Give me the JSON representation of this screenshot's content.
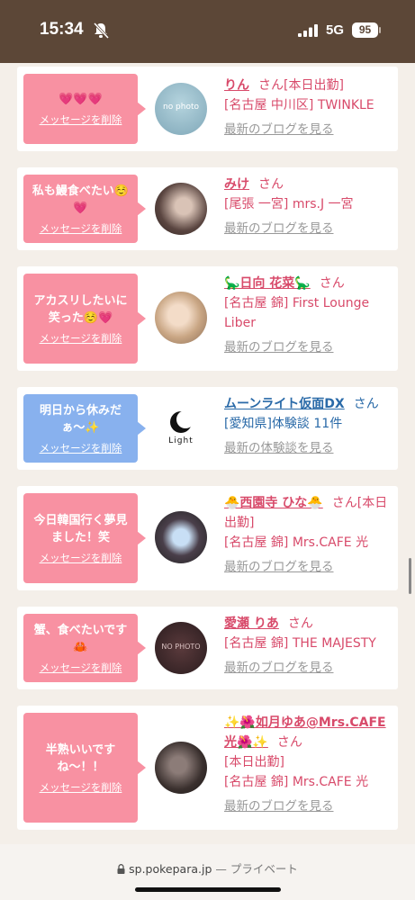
{
  "status_bar": {
    "time": "15:34",
    "network": "5G",
    "battery": "95"
  },
  "cards": [
    {
      "message": "💗💗💗",
      "delete_label": "メッセージを削除",
      "name": "りん",
      "honorific": "さん[本日出勤]",
      "lines": [
        "[名古屋 中川区] TWINKLE"
      ],
      "link": "最新のブログを見る",
      "avatar_text": "no photo"
    },
    {
      "message": "私も鰻食べたい☺️💗",
      "delete_label": "メッセージを削除",
      "name": "みけ",
      "honorific": "さん",
      "lines": [
        "[尾張 一宮] mrs.J 一宮"
      ],
      "link": "最新のブログを見る"
    },
    {
      "message": "アカスリしたいに笑った☺️💗",
      "delete_label": "メッセージを削除",
      "name": "🦕日向 花菜🦕",
      "honorific": "さん",
      "lines": [
        "[名古屋 錦] First Lounge Liber"
      ],
      "link": "最新のブログを見る"
    },
    {
      "message": "明日から休みだぁ〜✨",
      "delete_label": "メッセージを削除",
      "name": "ムーンライト仮面DX",
      "honorific": "さん",
      "lines": [
        "[愛知県]体験談 11件"
      ],
      "link": "最新の体験談を見る",
      "avatar_text": "Light"
    },
    {
      "message": "今日韓国行く夢見ました！笑",
      "delete_label": "メッセージを削除",
      "name": "🐣西園寺 ひな🐣",
      "honorific": "さん[本日出勤]",
      "lines": [
        "[名古屋 錦] Mrs.CAFE 光"
      ],
      "link": "最新のブログを見る"
    },
    {
      "message": "蟹、食べたいです🦀",
      "delete_label": "メッセージを削除",
      "name": "愛瀬 りあ",
      "honorific": "さん",
      "lines": [
        "[名古屋 錦] THE MAJESTY"
      ],
      "link": "最新のブログを見る",
      "avatar_text": "NO PHOTO"
    },
    {
      "message": "半熟いいですね〜！！",
      "delete_label": "メッセージを削除",
      "name": "✨🌺如月ゆあ@Mrs.CAFE光🌺✨",
      "honorific": "さん",
      "lines": [
        "[本日出勤]",
        "[名古屋 錦] Mrs.CAFE 光"
      ],
      "link": "最新のブログを見る"
    }
  ],
  "bottom_bar": {
    "url": "sp.pokepara.jp",
    "suffix": "— プライベート"
  },
  "colors": {
    "status_bar": "#5c4737",
    "pink_bubble": "#f891a2",
    "blue_bubble": "#88b1ee",
    "name_pink": "#d84a6a",
    "name_blue": "#2a6aa8"
  }
}
